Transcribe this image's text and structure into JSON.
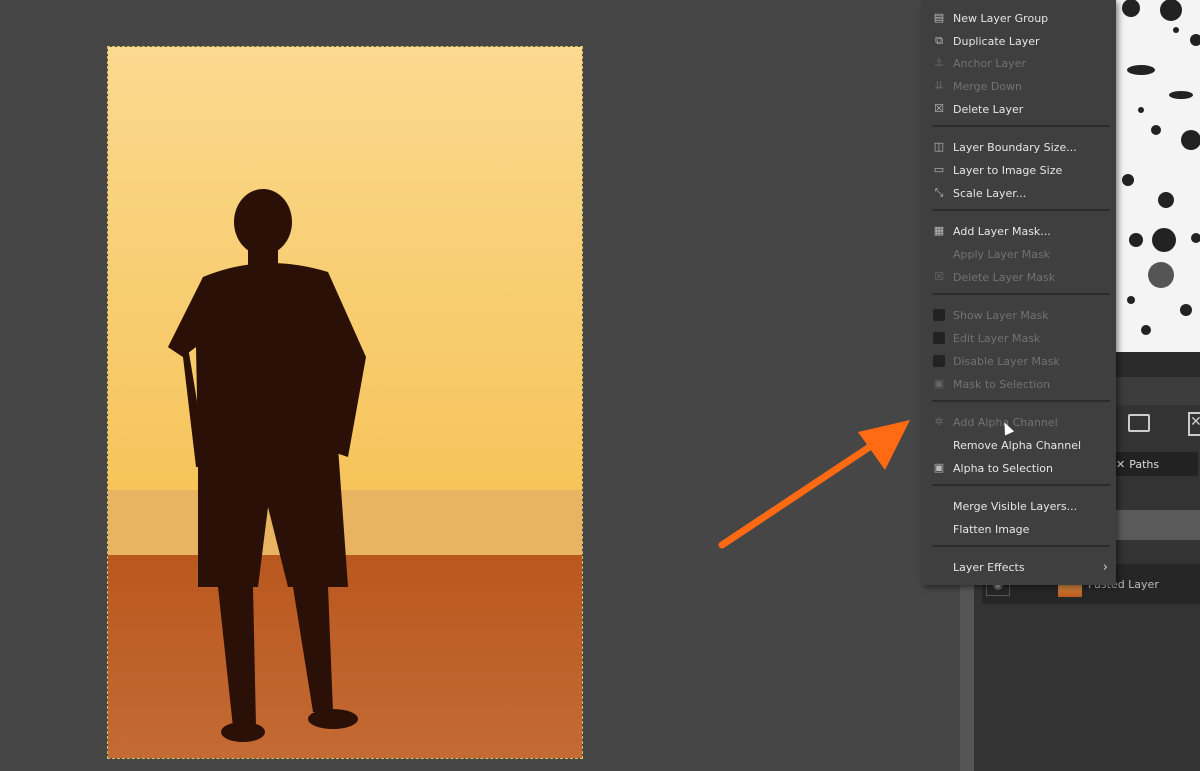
{
  "menu": {
    "items": [
      {
        "label": "New Layer Group",
        "icon": "layer-group-icon",
        "enabled": true
      },
      {
        "label": "Duplicate Layer",
        "icon": "duplicate-icon",
        "enabled": true
      },
      {
        "label": "Anchor Layer",
        "icon": "anchor-icon",
        "enabled": false
      },
      {
        "label": "Merge Down",
        "icon": "merge-down-icon",
        "enabled": false
      },
      {
        "label": "Delete Layer",
        "icon": "delete-icon",
        "enabled": true
      },
      {
        "label": "Layer Boundary Size...",
        "icon": "boundary-size-icon",
        "enabled": true
      },
      {
        "label": "Layer to Image Size",
        "icon": "layer-to-image-icon",
        "enabled": true
      },
      {
        "label": "Scale Layer...",
        "icon": "scale-icon",
        "enabled": true
      },
      {
        "label": "Add Layer Mask...",
        "icon": "add-mask-icon",
        "enabled": true
      },
      {
        "label": "Apply Layer Mask",
        "icon": "",
        "enabled": false
      },
      {
        "label": "Delete Layer Mask",
        "icon": "delete-icon",
        "enabled": false
      },
      {
        "label": "Show Layer Mask",
        "icon": "checkbox-icon",
        "enabled": false
      },
      {
        "label": "Edit Layer Mask",
        "icon": "checkbox-icon",
        "enabled": false
      },
      {
        "label": "Disable Layer Mask",
        "icon": "checkbox-icon",
        "enabled": false
      },
      {
        "label": "Mask to Selection",
        "icon": "mask-selection-icon",
        "enabled": false
      },
      {
        "label": "Add Alpha Channel",
        "icon": "alpha-icon",
        "enabled": false
      },
      {
        "label": "Remove Alpha Channel",
        "icon": "",
        "enabled": true
      },
      {
        "label": "Alpha to Selection",
        "icon": "alpha-selection-icon",
        "enabled": true
      },
      {
        "label": "Merge Visible Layers...",
        "icon": "",
        "enabled": true
      },
      {
        "label": "Flatten Image",
        "icon": "",
        "enabled": true
      },
      {
        "label": "Layer Effects",
        "icon": "",
        "enabled": true,
        "submenu": true
      }
    ]
  },
  "panel": {
    "tab_paths": "Paths",
    "layer_name": "Pasted Layer"
  },
  "accent": "#ff6a13"
}
